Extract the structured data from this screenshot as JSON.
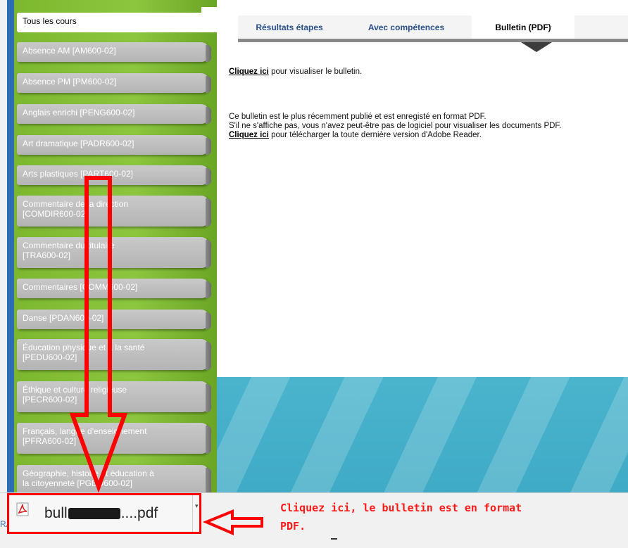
{
  "sidebar": {
    "courses": [
      {
        "line1": "Tous les cours",
        "line2": "",
        "active": true
      },
      {
        "line1": "Absence AM [AM600-02]",
        "line2": ""
      },
      {
        "line1": "Absence PM [PM600-02]",
        "line2": ""
      },
      {
        "line1": "Anglais enrichi [PENG600-02]",
        "line2": ""
      },
      {
        "line1": "Art dramatique [PADR600-02]",
        "line2": ""
      },
      {
        "line1": "Arts plastiques [PART600-02]",
        "line2": ""
      },
      {
        "line1": "Commentaire de la direction",
        "line2": "[COMDIR600-02]"
      },
      {
        "line1": "Commentaire du titulaire",
        "line2": "[TRA600-02]"
      },
      {
        "line1": "Commentaires [COMM600-02]",
        "line2": ""
      },
      {
        "line1": "Danse [PDAN600-02]",
        "line2": ""
      },
      {
        "line1": "Éducation physique et à la santé",
        "line2": "[PEDU600-02]"
      },
      {
        "line1": "Éthique et culture religieuse",
        "line2": "[PECR600-02]"
      },
      {
        "line1": "Français, langue d'enseignement",
        "line2": "[PFRA600-02]"
      },
      {
        "line1": "Géographie, histoire et éducation à",
        "line2": "la citoyenneté [PGEO600-02]"
      }
    ]
  },
  "tabs": [
    {
      "label": "Résultats étapes"
    },
    {
      "label": "Avec compétences"
    },
    {
      "label": "Bulletin (PDF)",
      "selected": true
    },
    {
      "label": ""
    }
  ],
  "content": {
    "view_link": "Cliquez ici",
    "view_text": " pour visualiser le bulletin.",
    "info_line1": "Ce bulletin est le plus récemment publié et est enregisté en format PDF.",
    "info_line2": "S'il ne s'affiche pas, vous n'avez peut-être pas de logiciel pour visualiser les documents PDF.",
    "download_link": "Cliquez ici",
    "download_text": " pour télécharger la toute dernière version d'Adobe Reader."
  },
  "download_bar": {
    "file_prefix": "bull",
    "file_suffix": "....pdf",
    "icon": "pdf-icon",
    "cut_text": "RA"
  },
  "annotation": {
    "text_line1": "Cliquez ici, le bulletin est en format",
    "text_line2": "PDF."
  },
  "colors": {
    "annotation": "#ff0000",
    "sidebar_green": "#8cc63f",
    "left_blue": "#2d6db5",
    "tab_text": "#2a4f8a"
  }
}
